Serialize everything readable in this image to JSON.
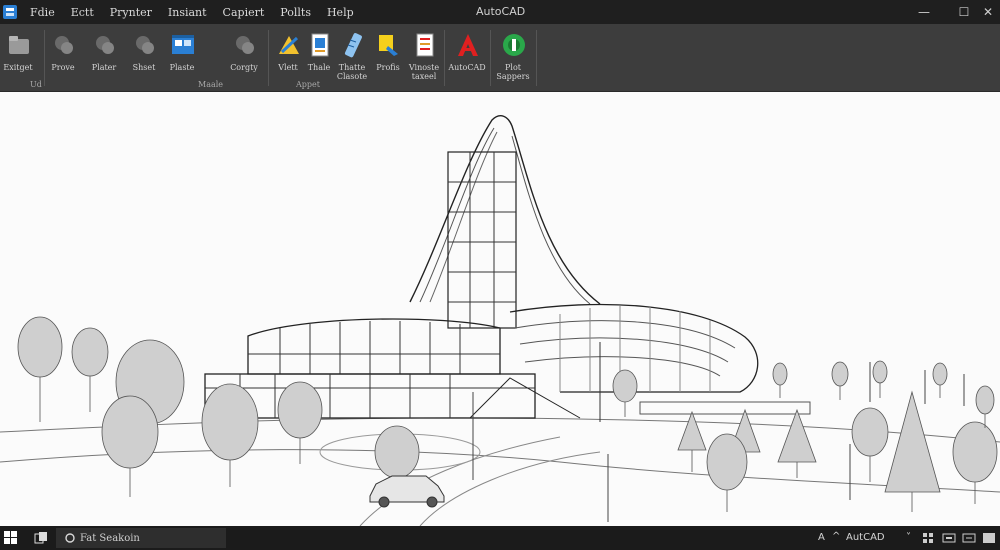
{
  "title": "AutoCAD",
  "menu": [
    "Fdie",
    "Ectt",
    "Prynter",
    "Insiant",
    "Capiert",
    "Pollts",
    "Help"
  ],
  "window_controls": [
    "—",
    "☐",
    "✕"
  ],
  "ribbon": {
    "buttons": [
      {
        "id": "exitget",
        "label": "Exitget"
      },
      {
        "id": "prove",
        "label": "Prove"
      },
      {
        "id": "plater",
        "label": "Plater"
      },
      {
        "id": "shset",
        "label": "Shset"
      },
      {
        "id": "plaste",
        "label": "Plaste"
      },
      {
        "id": "corgty",
        "label": "Corgty"
      },
      {
        "id": "vlett",
        "label": "Vlett"
      },
      {
        "id": "thale",
        "label": "Thale"
      },
      {
        "id": "thatte",
        "label": "Thatte\nClasote"
      },
      {
        "id": "profis",
        "label": "Profis"
      },
      {
        "id": "vinoste",
        "label": "Vinoste\ntaxeel"
      },
      {
        "id": "autocad",
        "label": "AutoCAD"
      },
      {
        "id": "plot",
        "label": "Plot\nSappers"
      }
    ],
    "groups": [
      "Ud",
      "Maale",
      "Appet"
    ]
  },
  "taskbar": {
    "search_text": "Fat Seakoin",
    "tray_label": "A",
    "tray_app": "AutCAD",
    "tray_chevron": "˅"
  },
  "colors": {
    "titlebar": "#1f1f1f",
    "ribbon": "#3d3d3d",
    "accent_red": "#e02020",
    "accent_green": "#2aa84a",
    "accent_blue": "#2a7fd4"
  }
}
